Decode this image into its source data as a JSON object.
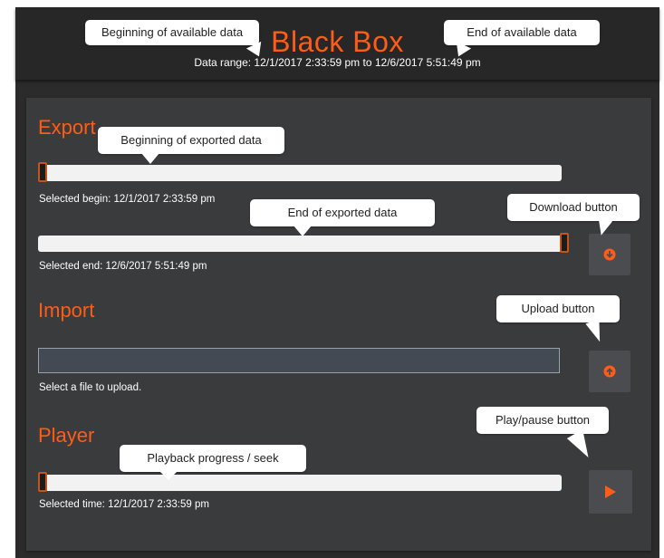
{
  "header": {
    "title": "Black Box",
    "data_range": "Data range: 12/1/2017 2:33:59 pm to 12/6/2017 5:51:49 pm"
  },
  "export": {
    "title": "Export",
    "begin_label": "Selected begin: 12/1/2017 2:33:59 pm",
    "end_label": "Selected end: 12/6/2017 5:51:49 pm",
    "begin_position_fraction": 0.0,
    "end_position_fraction": 1.0,
    "download_icon": "download-icon"
  },
  "import": {
    "title": "Import",
    "file_hint": "Select a file to upload.",
    "upload_icon": "upload-icon"
  },
  "player": {
    "title": "Player",
    "time_label": "Selected time: 12/1/2017 2:33:59 pm",
    "progress_fraction": 0.0,
    "play_icon": "play-icon"
  },
  "callouts": {
    "beginning_available": "Beginning of available data",
    "end_available": "End of available data",
    "beginning_exported": "Beginning of exported data",
    "end_exported": "End of exported data",
    "download_button": "Download button",
    "upload_button": "Upload button",
    "play_pause_button": "Play/pause button",
    "playback_progress": "Playback progress / seek"
  },
  "colors": {
    "accent": "#ff5d17",
    "background": "#2b2b2b",
    "panel": "#3a3b3d",
    "slider_track": "#f2f2f2",
    "button": "#4a4c50"
  }
}
